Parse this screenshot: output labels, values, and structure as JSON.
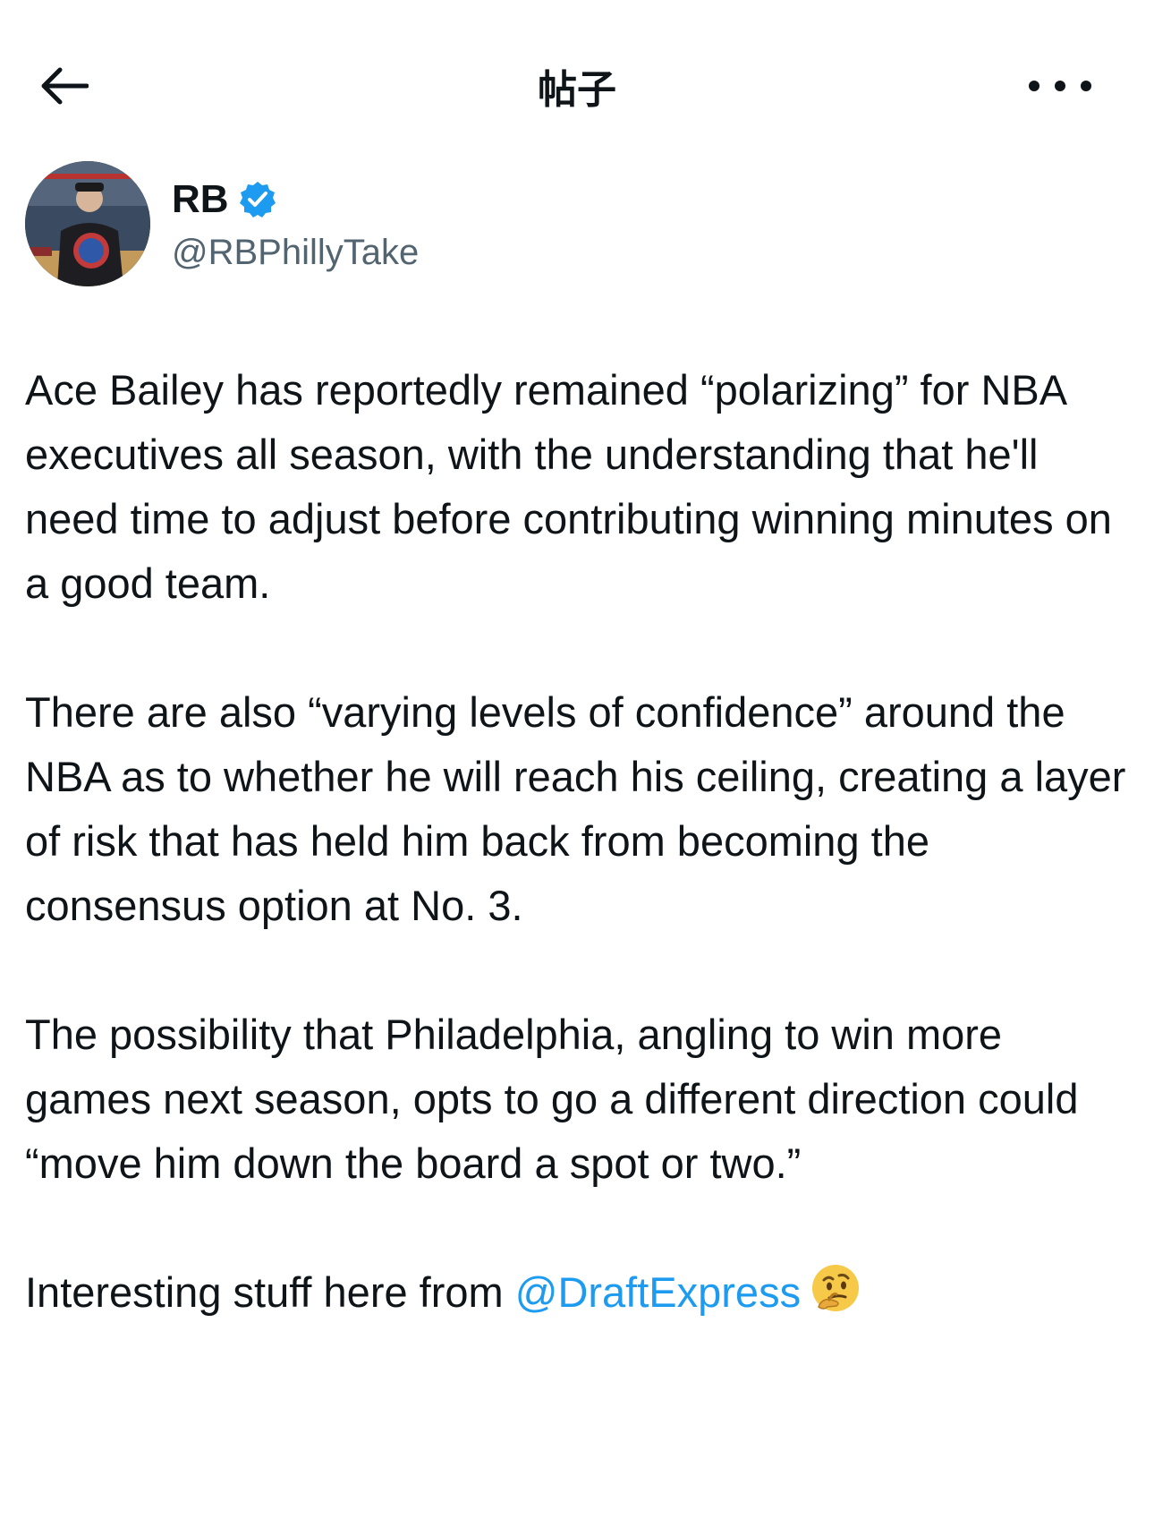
{
  "header": {
    "title": "帖子",
    "back_icon": "arrow-left-icon",
    "more_icon": "more-horizontal-icon"
  },
  "author": {
    "display_name": "RB",
    "handle": "@RBPhillyTake",
    "verified": true,
    "verified_color": "#1d9bf0"
  },
  "post": {
    "paragraphs": [
      "Ace Bailey has reportedly remained “polarizing” for NBA executives all season, with the understanding that he'll need time to adjust before contributing winning minutes on a good team.",
      "There are also “varying levels of confidence” around the NBA as to whether he will reach his ceiling, creating a layer of risk that has held him back from becoming the consensus option at No. 3.",
      "The possibility that Philadelphia, angling to win more games next season, opts to go a different direction could “move him down the board a spot or two.”"
    ],
    "last_line_prefix": "Interesting stuff here from ",
    "mention": "@DraftExpress",
    "emoji": "thinking-face-emoji",
    "link_color": "#1d9bf0"
  }
}
